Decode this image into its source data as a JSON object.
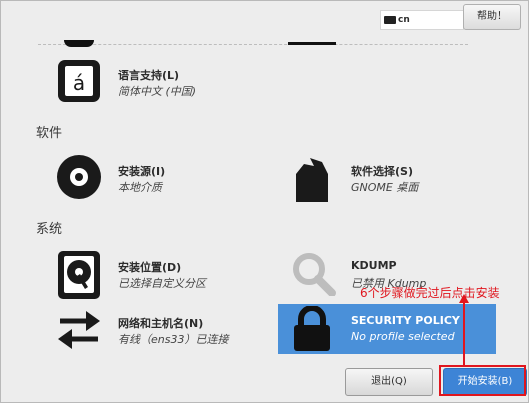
{
  "topbar": {
    "keyboard_layout": "cn",
    "help_button": "帮助！"
  },
  "sections": {
    "software": "软件",
    "system": "系统"
  },
  "spokes": {
    "language": {
      "title": "语言支持(L)",
      "status": "简体中文 (中国)"
    },
    "install_source": {
      "title": "安装源(I)",
      "status": "本地介质"
    },
    "software_selection": {
      "title": "软件选择(S)",
      "status": "GNOME 桌面"
    },
    "install_dest": {
      "title": "安装位置(D)",
      "status": "已选择自定义分区"
    },
    "kdump": {
      "title": "KDUMP",
      "status": "已禁用 Kdump"
    },
    "network": {
      "title": "网络和主机名(N)",
      "status": "有线（ens33）已连接"
    },
    "security": {
      "title": "SECURITY POLICY",
      "status": "No profile selected"
    }
  },
  "buttons": {
    "quit": "退出(Q)",
    "begin": "开始安装(B)"
  },
  "annotation": {
    "text": "6个步骤做完过后点击安装"
  },
  "colors": {
    "selected": "#4a90d9",
    "primary": "#3d84d6",
    "annotation": "#e0161e"
  }
}
